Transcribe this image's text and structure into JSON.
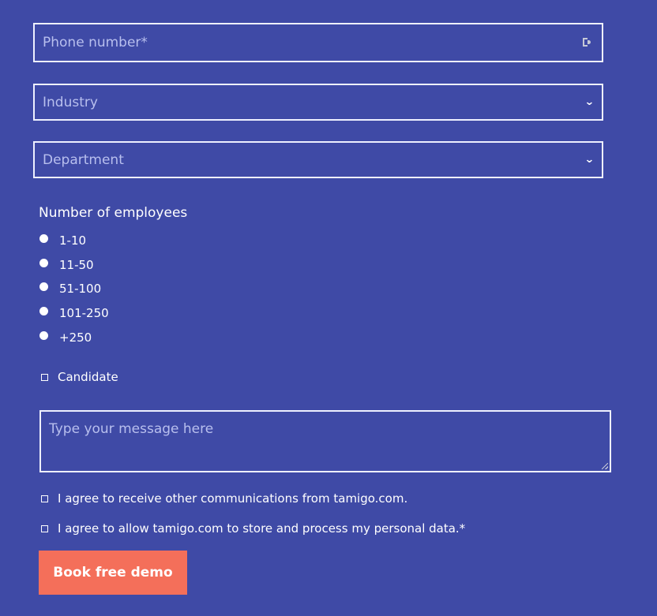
{
  "colors": {
    "background": "#3f4aa6",
    "field_border": "#eef0ff",
    "placeholder": "#b8bfee",
    "button": "#f46f5a",
    "text": "#ffffff"
  },
  "form": {
    "phone": {
      "placeholder": "Phone number*",
      "icon": "password-manager-key-icon"
    },
    "industry": {
      "placeholder": "Industry",
      "icon": "chevron-down-icon"
    },
    "department": {
      "placeholder": "Department",
      "icon": "chevron-down-icon"
    },
    "employees": {
      "label": "Number of employees",
      "options": [
        "1-10",
        "11-50",
        "51-100",
        "101-250",
        "+250"
      ]
    },
    "candidate": {
      "label": "Candidate"
    },
    "message": {
      "placeholder": "Type your message here"
    },
    "consent": {
      "communications": "I agree to receive other communications from tamigo.com.",
      "data_processing": "I agree to allow tamigo.com to store and process my personal data.*"
    },
    "submit_label": "Book free demo"
  }
}
